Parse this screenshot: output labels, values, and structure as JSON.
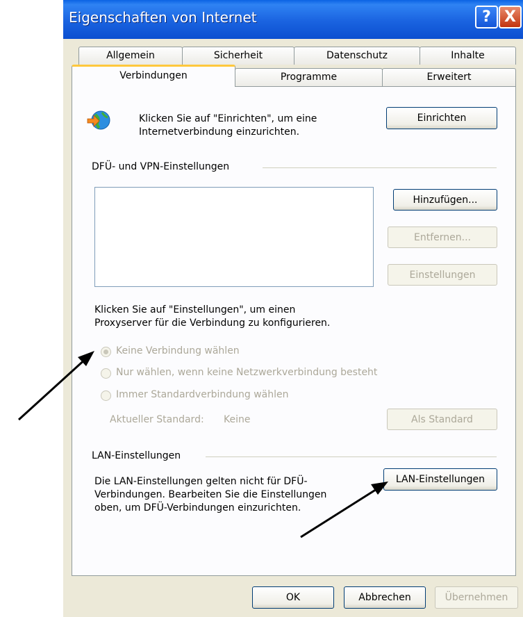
{
  "window": {
    "title": "Eigenschaften von Internet",
    "help_glyph": "?",
    "close_glyph": "X"
  },
  "tabs": {
    "row_back": [
      "Allgemein",
      "Sicherheit",
      "Datenschutz",
      "Inhalte"
    ],
    "row_front": [
      "Verbindungen",
      "Programme",
      "Erweitert"
    ],
    "active": "Verbindungen"
  },
  "setup": {
    "text_line1": "Klicken Sie auf \"Einrichten\", um eine",
    "text_line2": "Internetverbindung einzurichten.",
    "button": "Einrichten",
    "icon": "globe-arrow-icon"
  },
  "dialup": {
    "group_label": "DFÜ- und VPN-Einstellungen",
    "add_button": "Hinzufügen...",
    "remove_button": "Entfernen...",
    "settings_button": "Einstellungen",
    "proxy_line1": "Klicken Sie auf \"Einstellungen\", um einen",
    "proxy_line2": "Proxyserver für die Verbindung zu konfigurieren.",
    "radio_options": [
      "Keine Verbindung wählen",
      "Nur wählen, wenn keine Netzwerkverbindung besteht",
      "Immer Standardverbindung wählen"
    ],
    "selected_option": 0,
    "current_default_label": "Aktueller Standard:",
    "current_default_value": "Keine",
    "set_default_button": "Als Standard"
  },
  "lan": {
    "group_label": "LAN-Einstellungen",
    "text_line1": "Die LAN-Einstellungen gelten nicht für DFÜ-",
    "text_line2": "Verbindungen. Bearbeiten Sie die Einstellungen",
    "text_line3": "oben, um DFÜ-Verbindungen einzurichten.",
    "button": "LAN-Einstellungen"
  },
  "footer": {
    "ok": "OK",
    "cancel": "Abbrechen",
    "apply": "Übernehmen"
  },
  "colors": {
    "titlebar": "#1a63e0",
    "dialog_bg": "#ece9d8",
    "active_tab_accent": "#ffc83c",
    "disabled_text": "#aca899",
    "button_border": "#003c74"
  }
}
